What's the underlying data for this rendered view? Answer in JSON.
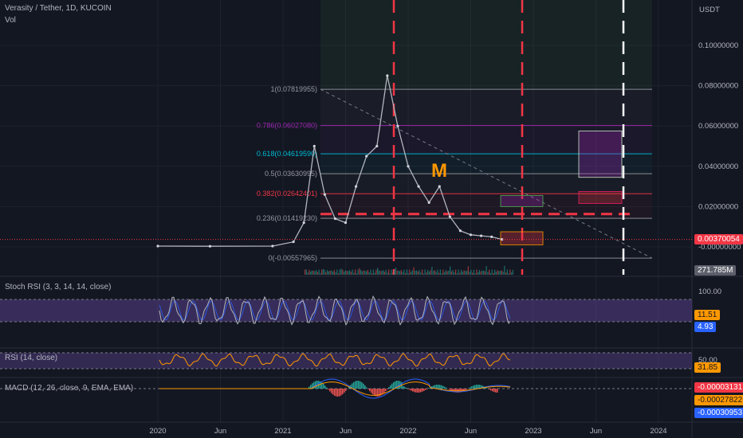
{
  "header": {
    "symbol": "Verasity / Tether, 1D, KUCOIN",
    "vol_label": "Vol",
    "currency": "USDT"
  },
  "price_axis": {
    "ticks": [
      "0.10000000",
      "0.08000000",
      "0.06000000",
      "0.04000000",
      "0.02000000",
      "-0.00000000"
    ],
    "values": [
      0.1,
      0.08,
      0.06,
      0.04,
      0.02,
      0.0
    ],
    "current_price": "0.00370054",
    "current_value": 0.0037,
    "volume_tag": "271.785M"
  },
  "time_axis": [
    "2020",
    "Jun",
    "2021",
    "Jun",
    "2022",
    "Jun",
    "2023",
    "Jun",
    "2024"
  ],
  "fib_levels": [
    {
      "label": "1(0.07819955)",
      "value": 0.0782,
      "color": "#9598a1"
    },
    {
      "label": "0.786(0.06027080)",
      "value": 0.0603,
      "color": "#9c27b0"
    },
    {
      "label": "0.618(0.04619590)",
      "value": 0.0462,
      "color": "#00bcd4"
    },
    {
      "label": "0.5(0.03630995)",
      "value": 0.0363,
      "color": "#9598a1"
    },
    {
      "label": "0.382(0.02642401)",
      "value": 0.0264,
      "color": "#f23645"
    },
    {
      "label": "0.236(0.01419230)",
      "value": 0.0142,
      "color": "#9598a1"
    },
    {
      "label": "0(-0.00557965)",
      "value": -0.0056,
      "color": "#9598a1"
    }
  ],
  "annotation": {
    "text": "M",
    "color": "#ff9800"
  },
  "stoch_rsi": {
    "title": "Stoch RSI (3, 3, 14, 14, close)",
    "axis_tick": "100.00",
    "k_value": "11.51",
    "d_value": "4.93",
    "k_color": "#ff9800",
    "d_color": "#2962ff"
  },
  "rsi": {
    "title": "RSI (14, close)",
    "axis_tick": "50.00",
    "value": "31.85",
    "color": "#ff9800"
  },
  "macd": {
    "title": "MACD (12, 26, close, 9, EMA, EMA)",
    "values": [
      "-0.00003131",
      "-0.00027822",
      "-0.00030953"
    ],
    "colors": [
      "#f23645",
      "#ff9800",
      "#2962ff"
    ]
  },
  "chart_data": {
    "type": "line",
    "title": "Verasity / Tether, 1D, KUCOIN",
    "ylabel": "USDT",
    "ylim": [
      -0.008,
      0.11
    ],
    "x": [
      "2020-01",
      "2020-06",
      "2020-12",
      "2021-02",
      "2021-03",
      "2021-04",
      "2021-05",
      "2021-06",
      "2021-07",
      "2021-08",
      "2021-09",
      "2021-10",
      "2021-11",
      "2021-12",
      "2022-01",
      "2022-02",
      "2022-03",
      "2022-04",
      "2022-05",
      "2022-06",
      "2022-07",
      "2022-08",
      "2022-09",
      "2022-10"
    ],
    "series": [
      {
        "values": [
          0.0004,
          0.0003,
          0.0004,
          0.0025,
          0.012,
          0.05,
          0.026,
          0.014,
          0.012,
          0.03,
          0.045,
          0.05,
          0.085,
          0.06,
          0.04,
          0.03,
          0.022,
          0.03,
          0.015,
          0.008,
          0.006,
          0.0055,
          0.005,
          0.0037
        ]
      }
    ]
  }
}
